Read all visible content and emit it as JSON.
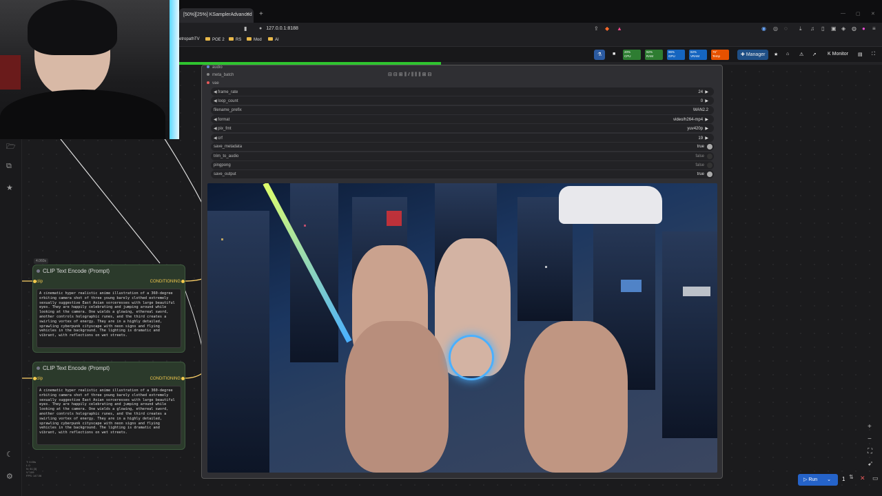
{
  "browser": {
    "tab_title": "[50%][25%] KSamplerAdvanced",
    "url": "127.0.0.1:8188",
    "bookmarks": [
      "etropathTV",
      "POE 2",
      "RS",
      "Mod",
      "AI"
    ]
  },
  "comfy_bar": {
    "stats": [
      {
        "label": "CPU",
        "value": "20%",
        "color": "#2e7d32"
      },
      {
        "label": "RAM",
        "value": "92%",
        "color": "#2e7d32"
      },
      {
        "label": "GPU",
        "value": "96%",
        "color": "#1565c0"
      },
      {
        "label": "VRAM",
        "value": "82%",
        "color": "#1565c0"
      },
      {
        "label": "Temp",
        "value": "76°",
        "color": "#e65100"
      }
    ],
    "manager_label": "Manager",
    "monitor_label": "Monitor"
  },
  "clip_nodes": [
    {
      "title": "CLIP Text Encode (Prompt)",
      "input_label": "clip",
      "output_label": "CONDITIONING",
      "text": "A cinematic hyper realistic anime illustration of a 360-degree orbiting camera shot of three young barely clothed extremely sexually suggestive East Asian sorceresses with large beautiful eyes. They are happily celebrating and jumping around while looking at the camera. One wields a glowing, ethereal sword, another controls holographic runes, and the third creates a swirling vortex of energy. They are in a highly detailed, sprawling cyberpunk cityscape with neon signs and flying vehicles in the background. The lighting is dramatic and vibrant, with reflections on wet streets."
    },
    {
      "title": "CLIP Text Encode (Prompt)",
      "input_label": "clip",
      "output_label": "CONDITIONING",
      "text": "A cinematic hyper realistic anime illustration of a 360-degree orbiting camera shot of three young barely clothed extremely sexually suggestive East Asian sorceresses with large beautiful eyes. They are happily celebrating and jumping around while looking at the camera. One wields a glowing, ethereal sword, another controls holographic runes, and the third creates a swirling vortex of energy. They are in a highly detailed, sprawling cyberpunk cityscape with neon signs and flying vehicles in the background. The lighting is dramatic and vibrant, with reflections on wet streets."
    }
  ],
  "time_tag": "4.060s",
  "video_node": {
    "inputs": [
      "audio",
      "meta_batch",
      "vae"
    ],
    "widgets": [
      {
        "label": "frame_rate",
        "value": "24",
        "kind": "number"
      },
      {
        "label": "loop_count",
        "value": "0",
        "kind": "number"
      },
      {
        "label": "filename_prefix",
        "value": "WAN2.2",
        "kind": "text"
      },
      {
        "label": "format",
        "value": "video/h264-mp4",
        "kind": "combo"
      },
      {
        "label": "pix_fmt",
        "value": "yuv420p",
        "kind": "combo"
      },
      {
        "label": "crf",
        "value": "19",
        "kind": "number"
      },
      {
        "label": "save_metadata",
        "value": "true",
        "kind": "toggle"
      },
      {
        "label": "trim_to_audio",
        "value": "false",
        "kind": "toggle"
      },
      {
        "label": "pingpong",
        "value": "false",
        "kind": "toggle"
      },
      {
        "label": "save_output",
        "value": "true",
        "kind": "toggle"
      }
    ]
  },
  "run": {
    "label": "Run",
    "count": "1"
  }
}
